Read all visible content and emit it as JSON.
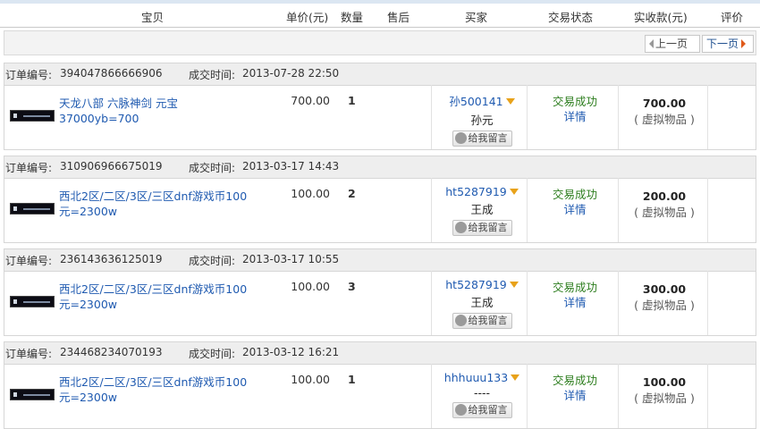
{
  "header": {
    "columns": [
      "宝贝",
      "单价(元)",
      "数量",
      "售后",
      "买家",
      "交易状态",
      "实收款(元)",
      "评价"
    ]
  },
  "pager": {
    "prev": "上一页",
    "next": "下一页"
  },
  "labels": {
    "order_no": "订单编号:",
    "deal_time": "成交时间:",
    "leave_message": "给我留言",
    "detail": "详情"
  },
  "orders": [
    {
      "order_no": "394047866666906",
      "deal_time": "2013-07-28 22:50",
      "item_title": "天龙八部 六脉神剑 元宝37000yb=700",
      "price": "700.00",
      "quantity": "1",
      "buyer_id": "孙500141",
      "buyer_name": "孙元",
      "status": "交易成功",
      "amount": "700.00",
      "item_type": "( 虚拟物品 )"
    },
    {
      "order_no": "310906966675019",
      "deal_time": "2013-03-17 14:43",
      "item_title": "西北2区/二区/3区/三区dnf游戏币100元=2300w",
      "price": "100.00",
      "quantity": "2",
      "buyer_id": "ht5287919",
      "buyer_name": "王成",
      "status": "交易成功",
      "amount": "200.00",
      "item_type": "( 虚拟物品 )"
    },
    {
      "order_no": "236143636125019",
      "deal_time": "2013-03-17 10:55",
      "item_title": "西北2区/二区/3区/三区dnf游戏币100元=2300w",
      "price": "100.00",
      "quantity": "3",
      "buyer_id": "ht5287919",
      "buyer_name": "王成",
      "status": "交易成功",
      "amount": "300.00",
      "item_type": "( 虚拟物品 )"
    },
    {
      "order_no": "234468234070193",
      "deal_time": "2013-03-12 16:21",
      "item_title": "西北2区/二区/3区/三区dnf游戏币100元=2300w",
      "price": "100.00",
      "quantity": "1",
      "buyer_id": "hhhuuu133",
      "buyer_name": "----",
      "status": "交易成功",
      "amount": "100.00",
      "item_type": "( 虚拟物品 )"
    }
  ]
}
